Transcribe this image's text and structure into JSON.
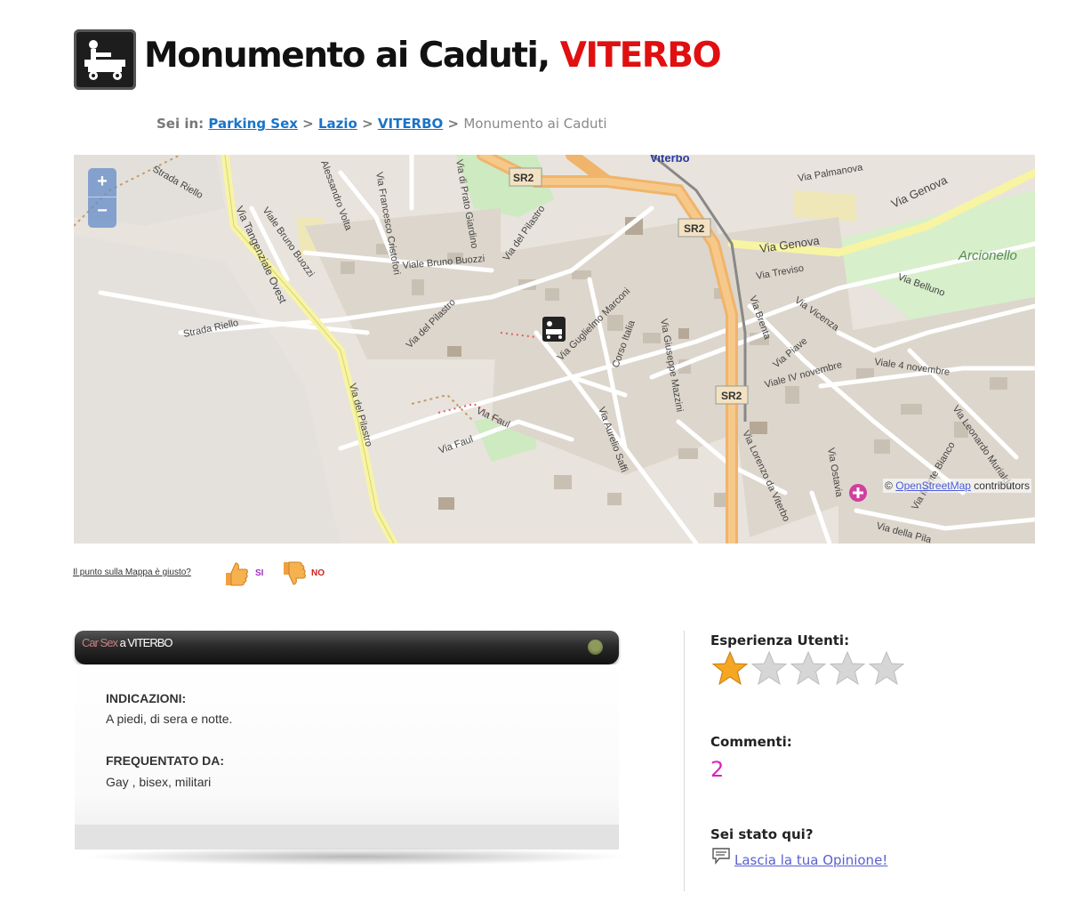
{
  "header": {
    "title_main": "Monumento ai Caduti,",
    "title_city": "VITERBO"
  },
  "breadcrumb": {
    "prefix": "Sei in:",
    "items": [
      "Parking Sex",
      "Lazio",
      "VITERBO"
    ],
    "separator": ">",
    "current": "Monumento ai Caduti"
  },
  "map": {
    "zoom_in": "+",
    "zoom_out": "−",
    "attribution_prefix": "©",
    "attribution_link": "OpenStreetMap",
    "attribution_suffix": "contributors",
    "labels": {
      "viterbo": "Viterbo",
      "arcionello": "Arcionello",
      "sr2": "SR2",
      "via_genova": "Via Genova",
      "via_palmanova": "Via Palmanova",
      "via_treviso": "Via Treviso",
      "via_belluno": "Via Belluno",
      "via_vicenza": "Via Vicenza",
      "via_piave": "Via Piave",
      "viale_iv_novembre": "Viale IV novembre",
      "viale_4_novembre": "Viale 4 novembre",
      "via_brenta": "Via Brenta",
      "via_leonardo": "Via Leonardo Murialdo",
      "via_monte_bianco": "Via Monte Bianco",
      "via_ostavia": "Via Ostavia",
      "via_della": "Via della Pila",
      "via_lorenzo": "Via Lorenzo da Viterbo",
      "via_giuseppe_mazzini": "Via Giuseppe Mazzini",
      "corso_italia": "Corso Italia",
      "via_guglielmo_marconi": "Via Guglielmo Marconi",
      "via_aurelio_saffi": "Via Aurelio Saffi",
      "via_faul": "Via Faul",
      "via_del_pilastro": "Via del Pilastro",
      "via_tangenziale": "Via Tangenziale Ovest",
      "strada_riello": "Strada Riello",
      "viale_bruno_buozzi": "Viale Bruno Buozzi",
      "via_francesco_cristofori": "Via Francesco Cristofori",
      "via_alessandro_volta": "Alessandro Volta",
      "via_di_prato_giardino": "Via di Prato Giardino"
    }
  },
  "feedback": {
    "question": "Il punto sulla Mappa è giusto?",
    "yes": "SI",
    "no": "NO"
  },
  "panel": {
    "title_prefix": "Car Sex",
    "title_suffix": "a VITERBO",
    "directions_label": "INDICAZIONI:",
    "directions_value": "A piedi, di sera e notte.",
    "frequented_label": "FREQUENTATO DA:",
    "frequented_value": "Gay , bisex, militari"
  },
  "sidebar": {
    "experience_label": "Esperienza Utenti:",
    "rating": 1,
    "rating_max": 5,
    "comments_label": "Commenti:",
    "comments_count": "2",
    "visited_label": "Sei stato qui?",
    "opinion_link": "Lascia la tua Opinione!"
  },
  "colors": {
    "city_red": "#e01010",
    "link_blue": "#1a73c8",
    "count_magenta": "#e020c0",
    "star_gold": "#f5a623",
    "star_grey": "#d6d6d6"
  }
}
